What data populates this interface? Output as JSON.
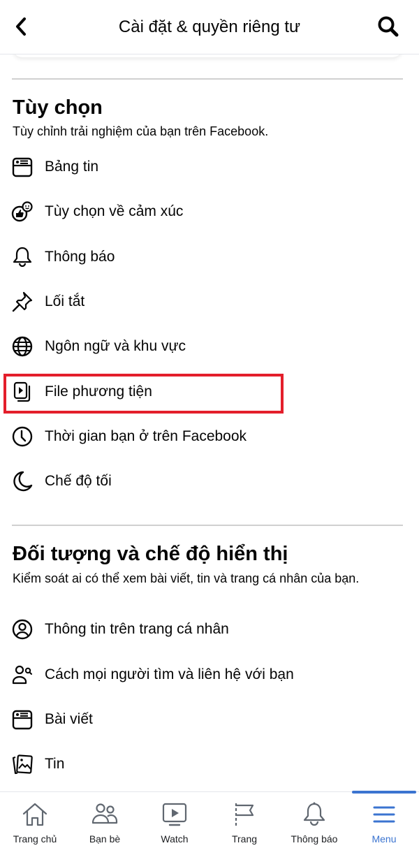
{
  "header": {
    "title": "Cài đặt & quyền riêng tư",
    "back_icon": "chevron-left-icon",
    "search_icon": "search-icon"
  },
  "sections": [
    {
      "title": "Tùy chọn",
      "subtitle": "Tùy chỉnh trải nghiệm của bạn trên Facebook.",
      "items": [
        {
          "label": "Bảng tin",
          "icon": "news-feed-icon"
        },
        {
          "label": "Tùy chọn về cảm xúc",
          "icon": "reactions-icon"
        },
        {
          "label": "Thông báo",
          "icon": "bell-icon"
        },
        {
          "label": "Lối tắt",
          "icon": "pin-icon"
        },
        {
          "label": "Ngôn ngữ và khu vực",
          "icon": "globe-icon"
        },
        {
          "label": "File phương tiện",
          "icon": "media-icon",
          "highlighted": true
        },
        {
          "label": "Thời gian bạn ở trên Facebook",
          "icon": "clock-icon"
        },
        {
          "label": "Chế độ tối",
          "icon": "moon-icon"
        }
      ]
    },
    {
      "title": "Đối tượng và chế độ hiển thị",
      "subtitle": "Kiểm soát ai có thể xem bài viết, tin và trang cá nhân của bạn.",
      "items": [
        {
          "label": "Thông tin trên trang cá nhân",
          "icon": "profile-icon"
        },
        {
          "label": "Cách mọi người tìm và liên hệ với bạn",
          "icon": "find-people-icon"
        },
        {
          "label": "Bài viết",
          "icon": "posts-icon"
        },
        {
          "label": "Tin",
          "icon": "stories-icon"
        }
      ]
    }
  ],
  "highlight_color": "#e31e2b",
  "bottom_nav": {
    "active_color": "#3b74d0",
    "items": [
      {
        "label": "Trang chủ",
        "icon": "home-icon",
        "active": false
      },
      {
        "label": "Bạn bè",
        "icon": "friends-icon",
        "active": false
      },
      {
        "label": "Watch",
        "icon": "watch-icon",
        "active": false
      },
      {
        "label": "Trang",
        "icon": "flag-icon",
        "active": false
      },
      {
        "label": "Thông báo",
        "icon": "bell-icon",
        "active": false
      },
      {
        "label": "Menu",
        "icon": "menu-icon",
        "active": true
      }
    ]
  }
}
